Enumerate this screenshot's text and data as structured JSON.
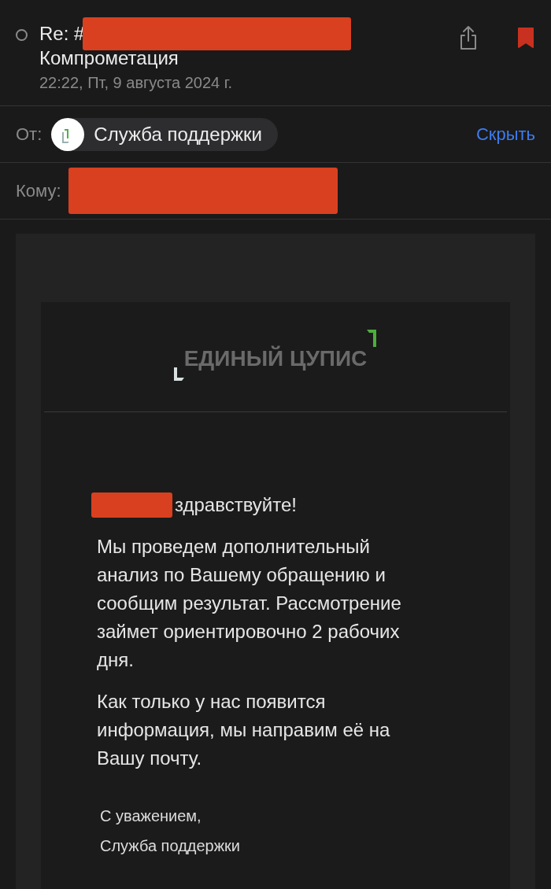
{
  "message": {
    "unread": false,
    "flagged": true,
    "subject_prefix": "Re: #",
    "subject_redacted": true,
    "subject_line2": "Компрометация",
    "date": "22:22, Пт, 9 августа 2024 г."
  },
  "from": {
    "label": "От:",
    "sender": "Служба поддержки",
    "action": "Скрыть"
  },
  "to": {
    "label": "Кому:",
    "redacted": true
  },
  "body": {
    "logo_text": "ЕДИНЫЙ ЦУПИС",
    "greeting_redacted": true,
    "greeting": "здравствуйте!",
    "paragraphs": [
      "Мы проведем дополнительный анализ по Вашему обращению и сообщим результат. Рассмотрение займет ориентировочно 2 рабочих дня.",
      "Как только у нас появится информация, мы направим её на Вашу почту."
    ],
    "signature": [
      "С уважением,",
      "Служба поддержки"
    ]
  }
}
